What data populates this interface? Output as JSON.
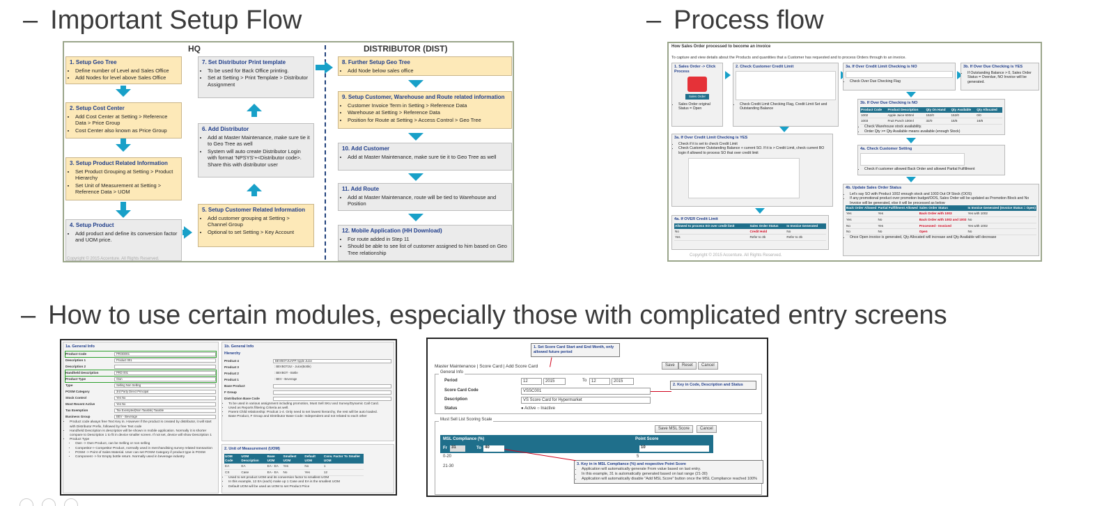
{
  "headings": {
    "setup": {
      "dash": "–",
      "text": "Important Setup Flow"
    },
    "process": {
      "dash": "–",
      "text": "Process flow"
    },
    "modules": {
      "dash": "–",
      "text": "How to use certain modules, especially those with complicated entry screens"
    }
  },
  "setup_flow": {
    "hq_title": "HQ",
    "dist_title": "DISTRIBUTOR (DIST)",
    "copyright": "Copyright © 2015 Accenture. All Rights Reserved.",
    "steps": [
      {
        "title": "1.  Setup Geo Tree",
        "bullets": [
          "Define number of Level and Sales Office",
          "Add Nodes for level above Sales Office"
        ]
      },
      {
        "title": "2. Setup Cost Center",
        "bullets": [
          "Add Cost Center at Setting > Reference Data > Price Group",
          "Cost Center also known as Price Group"
        ]
      },
      {
        "title": "3. Setup Product Related Information",
        "bullets": [
          "Set Product Grouping at Setting > Product Hierarchy",
          "Set Unit of Measurement at Setting > Reference Data > UOM"
        ]
      },
      {
        "title": "4. Setup Product",
        "bullets": [
          "Add product and define its conversion factor and UOM price."
        ]
      },
      {
        "title": "5. Setup Customer Related Information",
        "bullets": [
          "Add customer grouping at Setting > Channel Group",
          "Optional to set Setting > Key Account"
        ]
      },
      {
        "title": "6. Add Distributor",
        "bullets": [
          "Add at Master Maintenance, make sure tie it to Geo Tree as well",
          "System will auto create Distributor Login with format 'NPSYS'+<Distributor code>. Share this with distributor user"
        ]
      },
      {
        "title": "7. Set Distributor Print template",
        "bullets": [
          "To be used for Back Office printing.",
          "Set at Setting > Print Template > Distributor Assignment"
        ]
      },
      {
        "title": "8. Further Setup Geo Tree",
        "bullets": [
          "Add Node below sales office"
        ]
      },
      {
        "title": "9. Setup Customer, Warehouse and Route related information",
        "bullets": [
          "Customer Invoice Term in Setting > Reference Data",
          "Warehouse at Setting > Reference Data",
          "Position for Route at Setting > Access Control > Geo Tree"
        ]
      },
      {
        "title": "10. Add Customer",
        "bullets": [
          "Add at Master Maintenance, make sure tie it to Geo Tree as well"
        ]
      },
      {
        "title": "11. Add Route",
        "bullets": [
          "Add at Master Maintenance, route will be tied to Warehouse and Position"
        ]
      },
      {
        "title": "12. Mobile Application (HH Download)",
        "bullets": [
          "For route added in Step 11",
          "Should be able to see list of customer assigned to him based on Geo Tree relationship"
        ]
      }
    ]
  },
  "process_flow": {
    "header": "How Sales Order processed to become an invoice",
    "subheader": "To capture and view details about the Products and quantities that a Customer has requested and to process Orders through to an invoice.",
    "copyright": "Copyright © 2015 Accenture. All Rights Reserved.",
    "box1": {
      "title": "1.  Sales Order -> Click Process",
      "app_label": "Sales Order",
      "note": "Sales Order original Status = Open"
    },
    "box2": {
      "title": "2. Check Customer Credit Limit",
      "note": "Check Credit Limit Checking Flag, Credit Limit Set and Outstanding Balance"
    },
    "box3a": {
      "title": "3a. If Over Credit Limit Checking is NO",
      "note": "Check Over Due Checking Flag"
    },
    "box3b": {
      "title": "3b. If Over Due Checking is YES",
      "note": "If Outstanding Balance > 0, Sales Order Status = Overdue, NO Invoice will be generated."
    },
    "box3bno": {
      "title": "3b. If Over Due Checking is NO",
      "headers": [
        "Product Code",
        "Product Description",
        "Qty On Hand",
        "Qty Available",
        "Qty Allocated"
      ],
      "rows": [
        [
          "1002",
          "Apple Juice 600ml",
          "152/0",
          "152/0",
          "0/0"
        ],
        [
          "1003",
          "Fruit Punch 100ml",
          "32/0",
          "15/6",
          "16/6"
        ]
      ],
      "notes": [
        "Check Warehouse stock availability.",
        "Order Qty >= Qty Available means available (enough Stock)"
      ]
    },
    "box3ayes": {
      "title": "3a. If Over Credit Limit Checking is YES",
      "notes": [
        "Check if it is set to check Credit Limit",
        "Check Customer Outstanding Balance + current SO. If it is > Credit Limit, check current BO login if allowed to process SO that over credit limit"
      ]
    },
    "box4a": {
      "title": "4a. Check Customer Setting",
      "note": "Check if customer allowed Back Order and allowed Partial Fulfillment"
    },
    "box4aover": {
      "title": "4a. If OVER Credit Limit",
      "headers": [
        "Allowed to process SO over credit limit",
        "Sales Order Status",
        "Is Invoice Generated"
      ],
      "rows": [
        [
          "No",
          "Credit Hold",
          "No"
        ],
        [
          "Yes",
          "Refer to 3b",
          "Refer to 3b"
        ]
      ]
    },
    "box4b": {
      "title": "4b. Update Sales Order Status",
      "notes": [
        "Let's say SO with Product 1002 enough stock and 1003 Out Of Stock (OOS)",
        "If any promotional product over promotion budget/OOS, Sales Order will be updated as Promotion Block and No Invoice will be generated, else it will be processed as below"
      ],
      "headers": [
        "Back Order Allowed",
        "Partial Fulfillment Allowed",
        "Sales Order Status",
        "Is Invoice Generated (Invoice Status = Open)"
      ],
      "rows": [
        [
          "Yes",
          "Yes",
          "Back Order with 1003",
          "Yes with 1002"
        ],
        [
          "Yes",
          "No",
          "Back Order with 1002 and 1003",
          "No"
        ],
        [
          "No",
          "Yes",
          "Processed - Invoiced",
          "Yes with 1002"
        ],
        [
          "No",
          "No",
          "Open",
          "No"
        ]
      ],
      "footer": "Once Open invoice is generated, Qty Allocated will increase and Qty Available will decrease"
    }
  },
  "module1": {
    "general": {
      "title": "1a. General Info",
      "fields": [
        {
          "label": "Product Code",
          "value": "PROD001"
        },
        {
          "label": "Description 1",
          "value": "Product 001"
        },
        {
          "label": "Description 2",
          "value": ""
        },
        {
          "label": "Handheld Description",
          "value": "PRD 001"
        },
        {
          "label": "Product Type",
          "value": "Own"
        },
        {
          "label": "Type",
          "value": "Selling  Non Selling"
        },
        {
          "label": "POSM Category",
          "value": "3rd Party  Direct  Principal"
        },
        {
          "label": "Stock Control",
          "value": "Yes  No"
        },
        {
          "label": "Most Recent Active",
          "value": "Yes  No"
        },
        {
          "label": "Tax Exemption",
          "value": "Tax Exempted(Non Taxable)  Taxable"
        },
        {
          "label": "Business Group",
          "value": "BEV - Beverage"
        }
      ],
      "notes": [
        "Product code always free Text Key in. However if the product is created by distributor, it will start with Distributor Prefix, followed by free Text code",
        "Handheld Description is description will be shown in mobile application. Normally it is shorter compare to Description 1 to fit in device smaller screen. If not set, device will show Description 1",
        "Product Type",
        "Own -> Own Product, can be Selling or non selling",
        "Competitor-> Competitor Product, normally used in merchandising survey related transaction",
        "POSM -> Point of Sales Material. User can set POSM Category if product type is POSM",
        "Component -> for Empty bottle return. Normally used in beverage industry"
      ]
    },
    "hierarchy": {
      "title": "1b. General Info",
      "sub": "Hierarchy",
      "fields": [
        {
          "label": "Prodcat 4",
          "value": "BEVBOTJUAPP  Apple Juice"
        },
        {
          "label": "Prodcat 3",
          "value": ": BEVBOTJUI - Juice(Bottle)"
        },
        {
          "label": "Prodcat 2",
          "value": ": BEVBOT - Bottle"
        },
        {
          "label": "Prodcat 1",
          "value": ": BEV - Beverage"
        },
        {
          "label": "Base Product",
          "value": ""
        },
        {
          "label": "F Group",
          "value": ""
        },
        {
          "label": "Distribution Base Code",
          "value": ""
        }
      ],
      "notes": [
        "To be used in various assignment including promotion, Must Sell SKU and Survey/Dynamic Call Card.",
        "Used as Reports filtering Criteria as well.",
        "Parent Child relationship: Prodcat 1-4. Only need to set lowest hierarchy, the rest will be auto loaded.",
        "Base Product, F Group and Distributor Base Code: Independent and not related to each other"
      ]
    },
    "uom": {
      "title": "2. Unit of Measurement (UOM)",
      "headers": [
        "UOM Code",
        "UOM Description",
        "Base UOM",
        "Smallest UOM",
        "Default UOM",
        "Conv. Factor To Smaller UOM"
      ],
      "rows": [
        [
          "EA",
          "EA",
          "EA - EA",
          "Yes",
          "No",
          "1"
        ],
        [
          "CS",
          "Case",
          "EA - EA",
          "No",
          "Yes",
          "12"
        ]
      ],
      "notes": [
        "Used to set product UOM and its conversion factor to smallest UOM",
        "In this example, 12 EA (each) make up 1 Case and EA is the smallest UOM",
        "Default UOM will be used as UOM to set Product Price"
      ]
    }
  },
  "module2": {
    "breadcrumb": "Master Maintenance | Score Card | Add Score Card",
    "buttons": {
      "save": "Save",
      "reset": "Reset",
      "cancel": "Cancel",
      "save_msl": "Save MSL Score",
      "cancel2": "Cancel"
    },
    "general_legend": "General Info",
    "period_label": "Period",
    "period_from_month": "12",
    "period_from_year": "2015",
    "to_label": "To",
    "period_to_month": "12",
    "period_to_year": "2015",
    "code_label": "Score Card Code",
    "code_value": "VSSC001",
    "desc_label": "Description",
    "desc_value": "VS Score Card for Hypermarket",
    "status_label": "Status",
    "status_active": "Active",
    "status_inactive": "Inactive",
    "msl_legend": "Must Sell List Scoring Scale",
    "msl_col": "MSL Compliance (%)",
    "point_col": "Point Score",
    "fr_label": "Fr",
    "fr_value": "31",
    "to2_label": "To",
    "to2_value": "40",
    "point_value": "10",
    "rows": [
      [
        "0-20",
        "5"
      ],
      [
        "21-30",
        "7"
      ]
    ],
    "callout1": "1. Set Score Card Start and End Month, only allowed future period",
    "callout2": "2. Key in Code, Description and Status",
    "callout3_title": "3. Key in in MSL Compliance (%) and respective Point Score",
    "callout3_notes": [
      "Application will automatically generate From value based on last entry.",
      "In this example, 31 is automatically generated based on last range (21-30)",
      "Application will automatically disable \"Add MSL Score\" button once the MSL Compliance reached 100%"
    ]
  }
}
